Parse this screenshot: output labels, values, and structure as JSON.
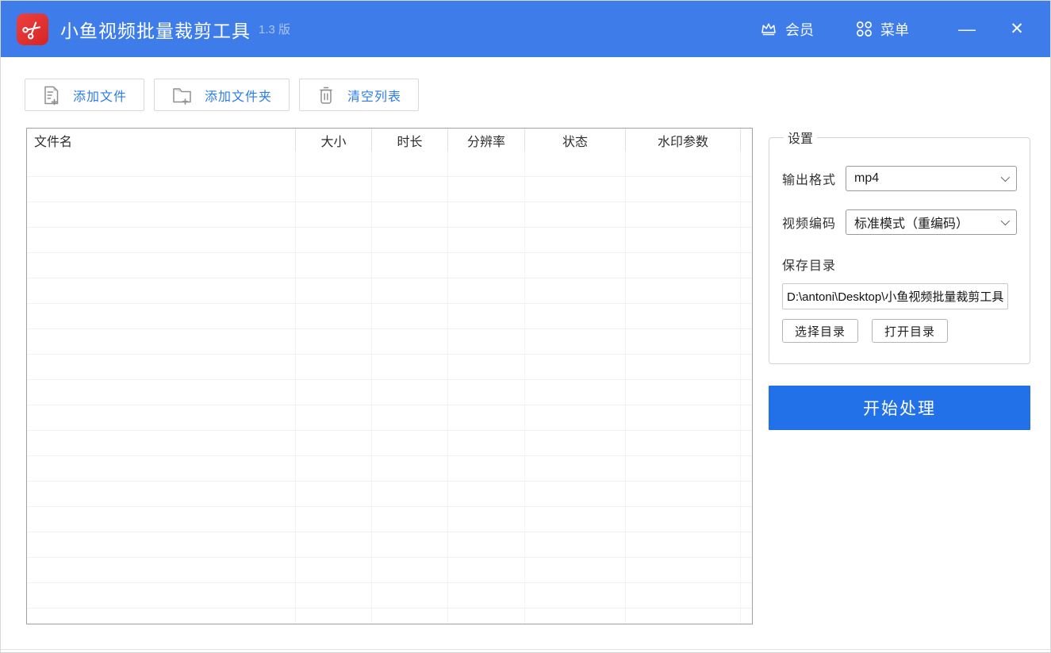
{
  "titlebar": {
    "title": "小鱼视频批量裁剪工具",
    "version": "1.3 版",
    "member_label": "会员",
    "menu_label": "菜单",
    "minimize_glyph": "—",
    "close_glyph": "✕"
  },
  "toolbar": {
    "add_file_label": "添加文件",
    "add_folder_label": "添加文件夹",
    "clear_list_label": "清空列表"
  },
  "table": {
    "columns": [
      "文件名",
      "大小",
      "时长",
      "分辨率",
      "状态",
      "水印参数"
    ],
    "rows": []
  },
  "settings": {
    "title": "设置",
    "output_format_label": "输出格式",
    "output_format_value": "mp4",
    "encoder_label": "视频编码",
    "encoder_value": "标准模式（重编码）",
    "save_dir_label": "保存目录",
    "save_dir_value": "D:\\antoni\\Desktop\\小鱼视频批量裁剪工具",
    "choose_dir_label": "选择目录",
    "open_dir_label": "打开目录"
  },
  "start_button": {
    "label": "开始处理"
  },
  "colors": {
    "titlebar_bg": "#3e7de9",
    "logo_bg": "#e13b3b",
    "accent": "#2b7ce9",
    "start_bg": "#2371e9",
    "table_border": "#a0a0a0"
  }
}
